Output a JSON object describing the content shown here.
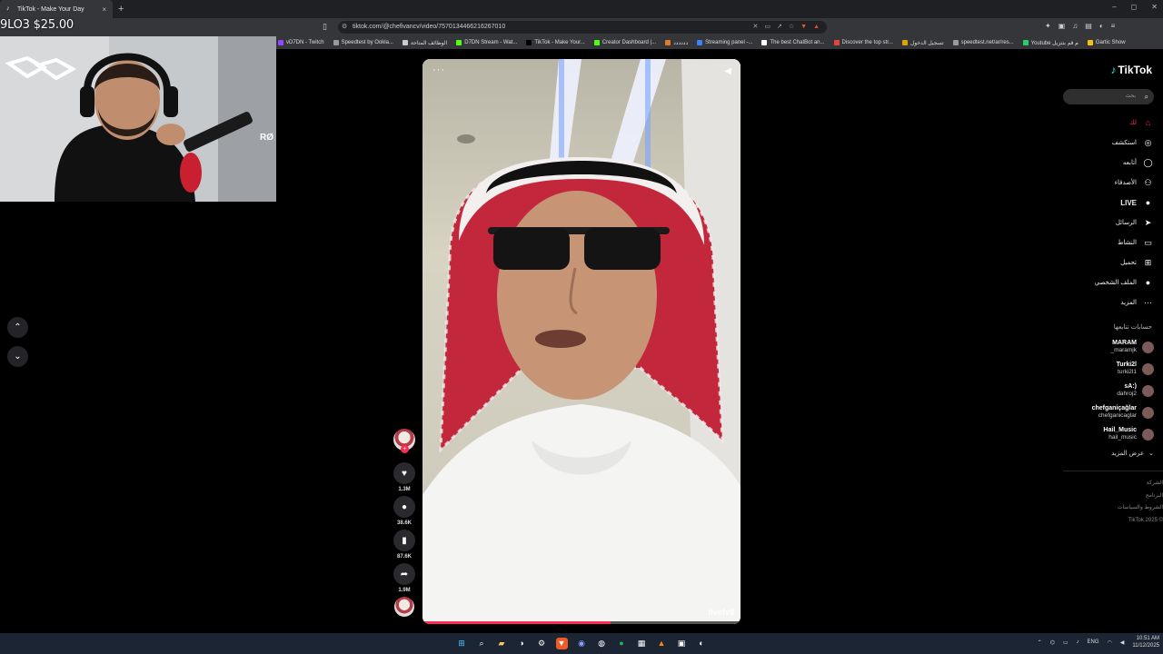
{
  "browser": {
    "tab_title": "TikTok - Make Your Day",
    "new_tab": "+",
    "close_tab": "×",
    "window_controls": [
      "–",
      "◻",
      "✕"
    ],
    "url": "tiktok.com/@chefivancv/video/7570134466216267010"
  },
  "bookmarks": [
    {
      "label": "vD7DN - Twitch",
      "color": "#9146ff"
    },
    {
      "label": "Speedtest by Ookla...",
      "color": "#9a9a9a"
    },
    {
      "label": "الوظائف المتاحة",
      "color": "#cccccc"
    },
    {
      "label": "D7DN Stream - Wat...",
      "color": "#53fc18"
    },
    {
      "label": "TikTok - Make Your...",
      "color": "#000000"
    },
    {
      "label": "Creator Dashboard |...",
      "color": "#53fc18"
    },
    {
      "label": "دددددد",
      "color": "#e07b2a"
    },
    {
      "label": "Streaming panel -...",
      "color": "#3b82f6"
    },
    {
      "label": "The best ChatBot an...",
      "color": "#ffffff"
    },
    {
      "label": "Discover the top str...",
      "color": "#e0463a"
    },
    {
      "label": "تسجيل الدخول",
      "color": "#d9a400"
    },
    {
      "label": "speedtest.net/ar/res...",
      "color": "#9a9a9a"
    },
    {
      "label": "Youtube م قم بتنزيل",
      "color": "#2ecc71"
    },
    {
      "label": "Gartic Show",
      "color": "#f1c40f"
    }
  ],
  "overlay": {
    "counter": "9LO3 $25.00"
  },
  "video": {
    "more": "···",
    "handle": "fivefv8",
    "progress": 0.59
  },
  "rail": {
    "likes": "1.3M",
    "comments": "38.6K",
    "saves": "87.6K",
    "shares": "1.9M"
  },
  "sidebar": {
    "logo": "TikTok",
    "search_placeholder": "بحث",
    "nav": [
      {
        "label": "لك",
        "icon": "home-icon",
        "glyph": "⌂",
        "active": true
      },
      {
        "label": "استكشف",
        "icon": "compass-icon",
        "glyph": "◎",
        "active": false
      },
      {
        "label": "أتابعه",
        "icon": "following-icon",
        "glyph": "◯",
        "active": false
      },
      {
        "label": "الأصدقاء",
        "icon": "friends-icon",
        "glyph": "⚇",
        "active": false
      },
      {
        "label": "LIVE",
        "icon": "live-icon",
        "glyph": "●",
        "active": false
      },
      {
        "label": "الرسائل",
        "icon": "messages-icon",
        "glyph": "➤",
        "active": false
      },
      {
        "label": "النشاط",
        "icon": "activity-icon",
        "glyph": "▭",
        "active": false
      },
      {
        "label": "تحميل",
        "icon": "upload-icon",
        "glyph": "⊞",
        "active": false
      },
      {
        "label": "الملف الشخصي",
        "icon": "profile-icon",
        "glyph": "●",
        "active": false
      },
      {
        "label": "المزيد",
        "icon": "more-icon",
        "glyph": "···",
        "active": false
      }
    ],
    "following_title": "حسابات تتابعها",
    "following": [
      {
        "name": "MARAM",
        "handle": "_maramjk"
      },
      {
        "name": "Turki2l",
        "handle": "turki2l1"
      },
      {
        "name": "sA:)",
        "handle": "dahroj2"
      },
      {
        "name": "chefganiçağlar",
        "handle": "chefganicaglar"
      },
      {
        "name": "Hail_Music",
        "handle": "hail_music"
      }
    ],
    "show_more": "عرض المزيد",
    "footer": [
      "الشركة",
      "البرنامج",
      "الشروط والسياسات",
      "TikTok 2025 ©"
    ]
  },
  "taskbar": {
    "lang": "ENG",
    "time": "10:51 AM",
    "date": "11/12/2025"
  }
}
